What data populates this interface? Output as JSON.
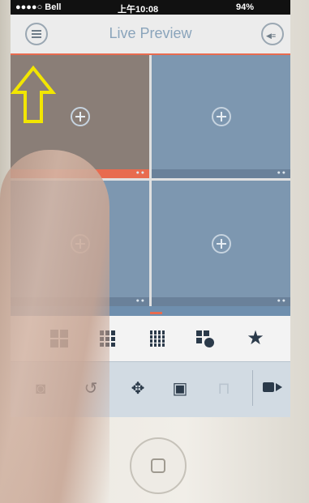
{
  "status": {
    "carrier": "●●●●○ Bell",
    "time": "上午10:08",
    "battery": "94%"
  },
  "nav": {
    "title": "Live Preview"
  },
  "grid": {
    "cells": [
      {
        "selected": true
      },
      {
        "selected": false
      },
      {
        "selected": false
      },
      {
        "selected": false
      }
    ]
  },
  "layout_toolbar": {
    "icons": [
      "quad-layout-icon",
      "nine-layout-icon",
      "sixteen-layout-icon",
      "playback-layout-icon",
      "favorites-star-icon"
    ]
  },
  "bottom_toolbar": {
    "icons": [
      "snapshot-camera-icon",
      "playback-history-icon",
      "ptz-move-icon",
      "image-settings-icon",
      "unlock-icon",
      "record-video-icon"
    ]
  },
  "colors": {
    "accent": "#e86b4f",
    "annotation": "#f2e600",
    "cell": "#7d97b0"
  }
}
